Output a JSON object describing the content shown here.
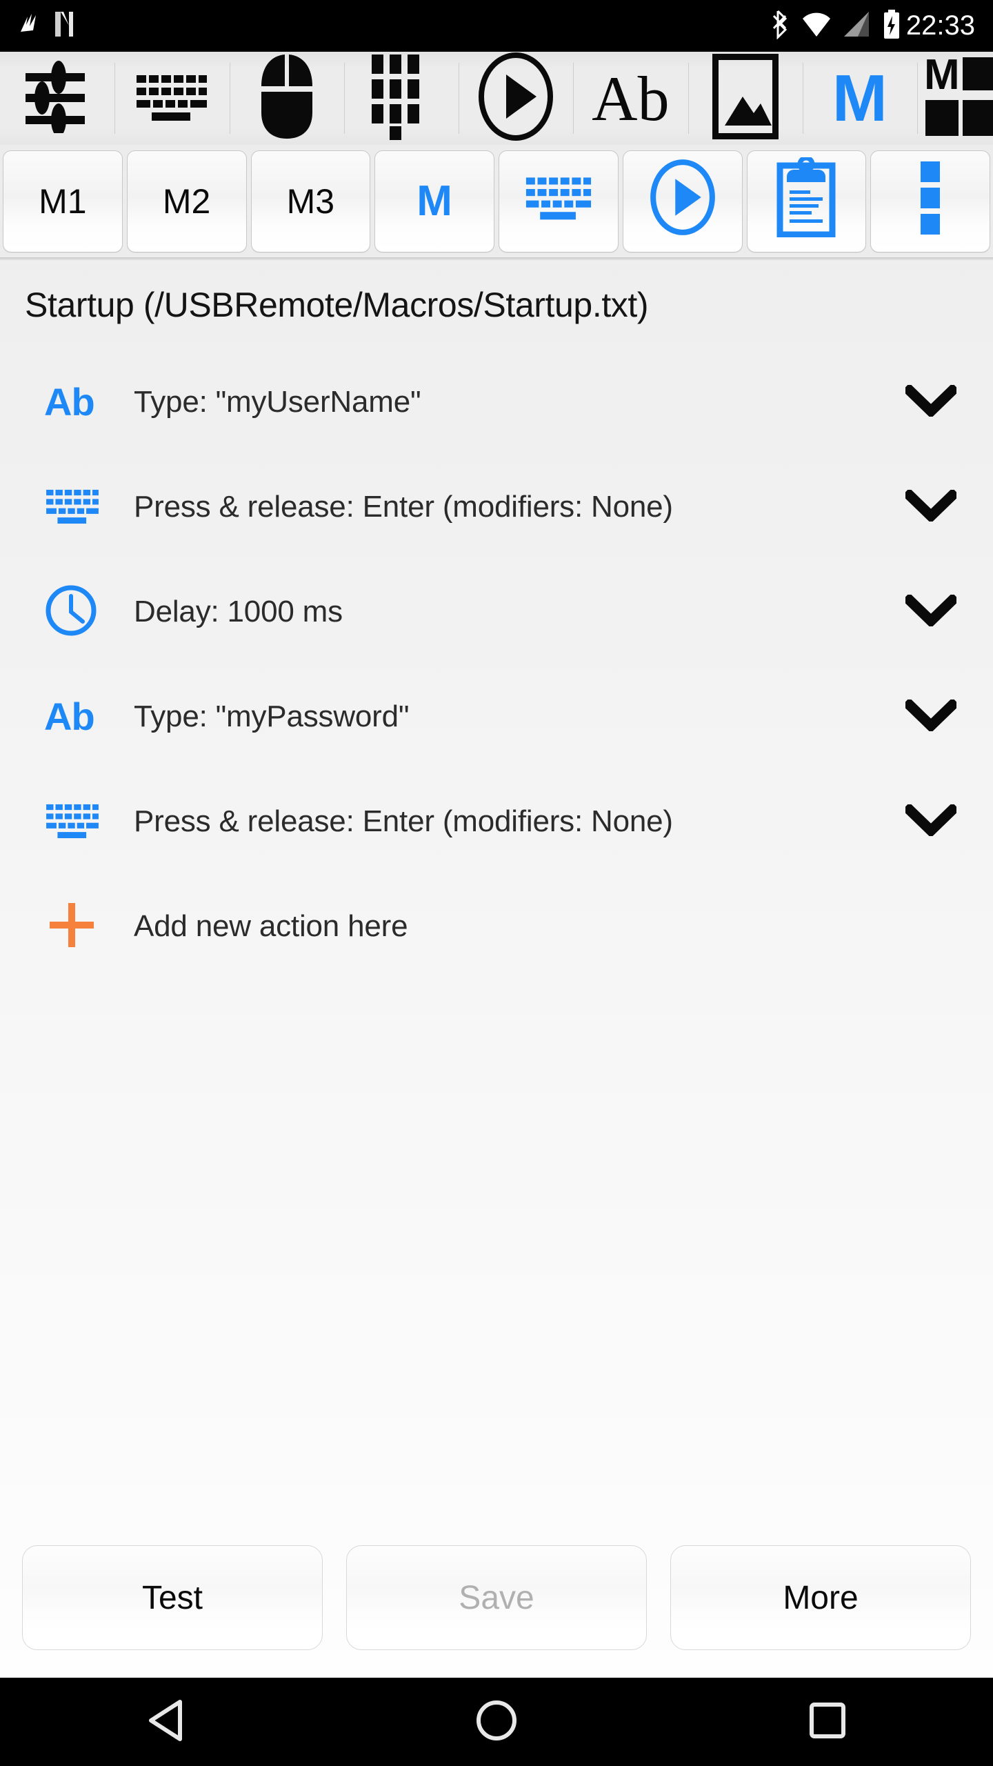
{
  "statusbar": {
    "time": "22:33",
    "icons_left": [
      "nfc-icon",
      "n-logo-icon"
    ],
    "icons_right": [
      "bluetooth-icon",
      "wifi-icon",
      "cellular-signal-icon",
      "battery-charging-icon"
    ]
  },
  "toolbar_icons": [
    {
      "name": "settings-sliders-icon",
      "label": "Settings"
    },
    {
      "name": "keyboard-icon",
      "label": "Keyboard"
    },
    {
      "name": "mouse-icon",
      "label": "Mouse"
    },
    {
      "name": "numpad-icon",
      "label": "Numpad"
    },
    {
      "name": "play-icon",
      "label": "Play"
    },
    {
      "name": "text-ab-icon",
      "label": "Ab"
    },
    {
      "name": "image-icon",
      "label": "Image"
    },
    {
      "name": "macro-m-icon",
      "label": "M"
    },
    {
      "name": "macro-grid-icon",
      "label": "M grid"
    }
  ],
  "toolbar_buttons": [
    {
      "name": "macro-m1-button",
      "label": "M1",
      "type": "text"
    },
    {
      "name": "macro-m2-button",
      "label": "M2",
      "type": "text"
    },
    {
      "name": "macro-m3-button",
      "label": "M3",
      "type": "text"
    },
    {
      "name": "macro-m-button",
      "label": "M",
      "type": "text-blue"
    },
    {
      "name": "keyboard-button",
      "label": "",
      "type": "keyboard-icon"
    },
    {
      "name": "play-button",
      "label": "",
      "type": "play-icon"
    },
    {
      "name": "clipboard-button",
      "label": "",
      "type": "clipboard-icon"
    },
    {
      "name": "overflow-menu-button",
      "label": "",
      "type": "more-vert-icon"
    }
  ],
  "macro": {
    "title": "Startup (/USBRemote/Macros/Startup.txt)",
    "actions": [
      {
        "icon": "text-ab-icon",
        "label": "Type: \"myUserName\"",
        "chevron": "chevron-down-icon"
      },
      {
        "icon": "keyboard-icon",
        "label": "Press & release: Enter (modifiers: None)",
        "chevron": "chevron-down-icon"
      },
      {
        "icon": "clock-icon",
        "label": "Delay: 1000 ms",
        "chevron": "chevron-down-icon"
      },
      {
        "icon": "text-ab-icon",
        "label": "Type: \"myPassword\"",
        "chevron": "chevron-down-icon"
      },
      {
        "icon": "keyboard-icon",
        "label": "Press & release: Enter (modifiers: None)",
        "chevron": "chevron-down-icon"
      }
    ],
    "add_action": {
      "icon": "plus-icon",
      "label": "Add new action here"
    }
  },
  "bottom_buttons": [
    {
      "name": "test-button",
      "label": "Test",
      "enabled": true
    },
    {
      "name": "save-button",
      "label": "Save",
      "enabled": false
    },
    {
      "name": "more-button",
      "label": "More",
      "enabled": true
    }
  ],
  "navbar": [
    {
      "name": "nav-back-button",
      "icon": "back-triangle-icon"
    },
    {
      "name": "nav-home-button",
      "icon": "home-circle-icon"
    },
    {
      "name": "nav-recents-button",
      "icon": "recents-square-icon"
    }
  ],
  "colors": {
    "accent_blue": "#1e88f7",
    "accent_orange": "#f5813c",
    "text_primary": "#2b2b2b",
    "text_disabled": "#b0b0b0",
    "statusbar_bg": "#000000",
    "toolbar_bg": "#ececec"
  }
}
